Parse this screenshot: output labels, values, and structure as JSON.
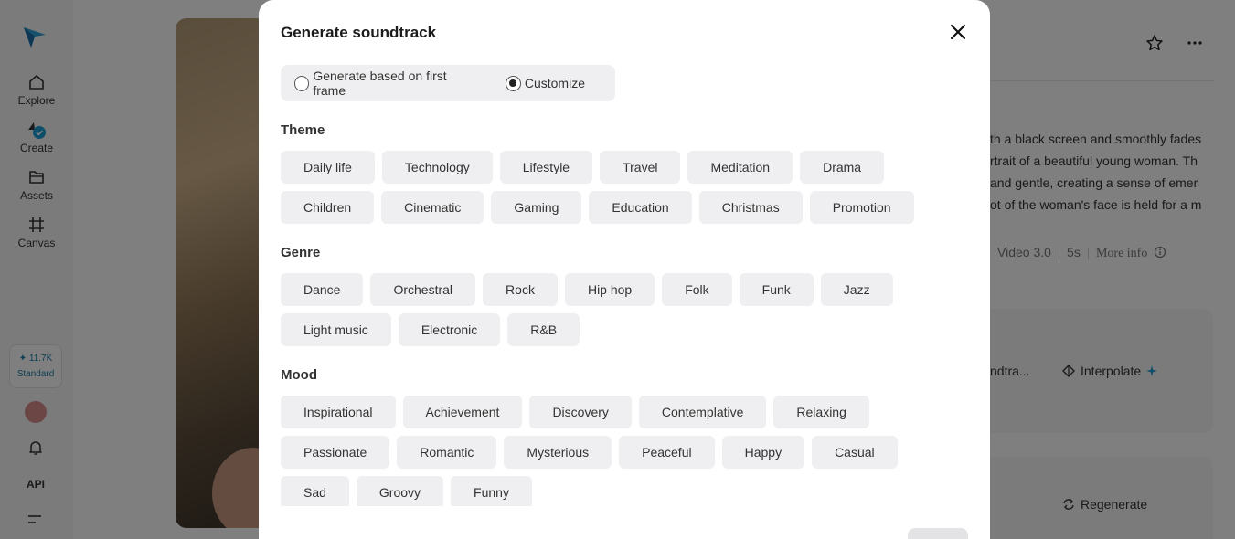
{
  "sidebar": {
    "items": [
      {
        "label": "Explore",
        "icon": "home-icon"
      },
      {
        "label": "Create",
        "icon": "create-icon"
      },
      {
        "label": "Assets",
        "icon": "folder-icon"
      },
      {
        "label": "Canvas",
        "icon": "canvas-icon"
      }
    ],
    "credits": {
      "amount": "✦ 11.7K",
      "plan": "Standard"
    },
    "api_label": "API"
  },
  "right_panel": {
    "description_lines": [
      "th a black screen and smoothly fades",
      "rtrait of a beautiful young woman. Th",
      "and gentle, creating a sense of emer",
      "ot of the woman's face is held for a m"
    ],
    "model": "Video 3.0",
    "duration": "5s",
    "more_info": "More info",
    "soundtrack_truncated": "ndtra...",
    "interpolate_label": "Interpolate",
    "regenerate_label": "Regenerate"
  },
  "modal": {
    "title": "Generate soundtrack",
    "mode_options": [
      {
        "label": "Generate based on first frame",
        "checked": false
      },
      {
        "label": "Customize",
        "checked": true
      }
    ],
    "sections": {
      "theme": {
        "label": "Theme",
        "rows": [
          [
            "Daily life",
            "Technology",
            "Lifestyle",
            "Travel",
            "Meditation",
            "Drama"
          ],
          [
            "Children",
            "Cinematic",
            "Gaming",
            "Education",
            "Christmas",
            "Promotion"
          ]
        ]
      },
      "genre": {
        "label": "Genre",
        "rows": [
          [
            "Dance",
            "Orchestral",
            "Rock",
            "Hip hop",
            "Folk",
            "Funk",
            "Jazz"
          ],
          [
            "Light music",
            "Electronic",
            "R&B"
          ]
        ]
      },
      "mood": {
        "label": "Mood",
        "rows": [
          [
            "Inspirational",
            "Achievement",
            "Discovery",
            "Contemplative",
            "Relaxing"
          ],
          [
            "Passionate",
            "Romantic",
            "Mysterious",
            "Peaceful",
            "Happy",
            "Casual"
          ],
          [
            "Sad",
            "Groovy",
            "Funny"
          ]
        ]
      }
    }
  },
  "colors": {
    "accent": "#1a9fd4",
    "chip_bg": "#efeff1",
    "overlay": "rgba(0,0,0,0.5)"
  }
}
